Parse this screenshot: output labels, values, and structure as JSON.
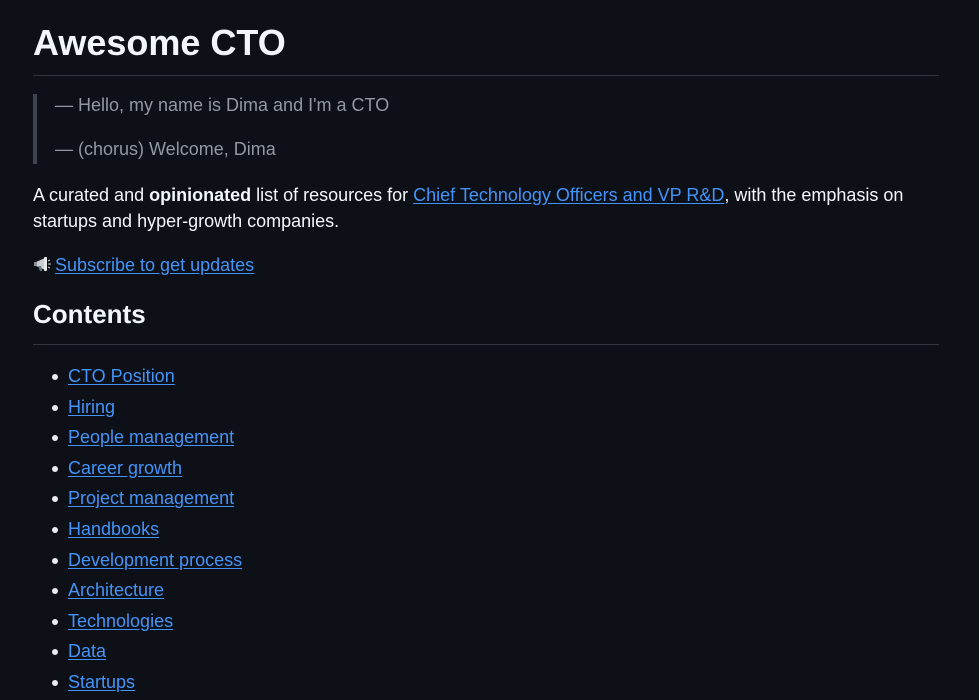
{
  "title": "Awesome CTO",
  "quote": {
    "line1": "— Hello, my name is Dima and I'm a CTO",
    "line2": "— (chorus) Welcome, Dima"
  },
  "intro": {
    "part1": "A curated and ",
    "bold": "opinionated",
    "part2": " list of resources for ",
    "link": "Chief Technology Officers and VP R&D",
    "part3": ", with the emphasis on startups and hyper-growth companies."
  },
  "subscribe": {
    "icon": "megaphone-icon",
    "link": "Subscribe to get updates"
  },
  "contents": {
    "heading": "Contents",
    "items": [
      "CTO Position",
      "Hiring",
      "People management",
      "Career growth",
      "Project management",
      "Handbooks",
      "Development process",
      "Architecture",
      "Technologies",
      "Data",
      "Startups"
    ]
  },
  "colors": {
    "background": "#0d1117",
    "text": "#f0f6fc",
    "muted": "#9198a1",
    "link": "#4493f8",
    "border": "#30363d"
  }
}
